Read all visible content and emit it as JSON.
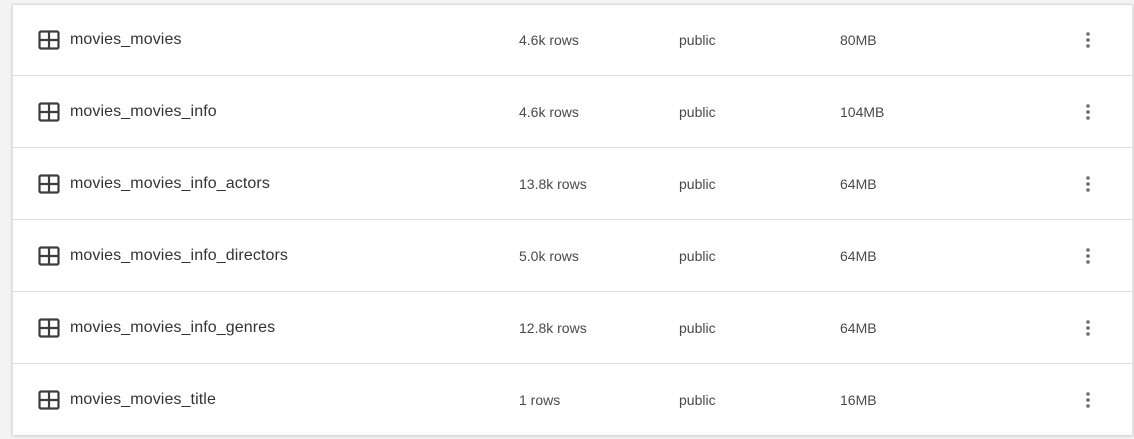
{
  "tables": [
    {
      "name": "movies_movies",
      "rows": "4.6k rows",
      "schema": "public",
      "size": "80MB",
      "icon": "table-icon",
      "menu_icon": "more-vert-icon"
    },
    {
      "name": "movies_movies_info",
      "rows": "4.6k rows",
      "schema": "public",
      "size": "104MB",
      "icon": "table-icon",
      "menu_icon": "more-vert-icon"
    },
    {
      "name": "movies_movies_info_actors",
      "rows": "13.8k rows",
      "schema": "public",
      "size": "64MB",
      "icon": "table-icon",
      "menu_icon": "more-vert-icon"
    },
    {
      "name": "movies_movies_info_directors",
      "rows": "5.0k rows",
      "schema": "public",
      "size": "64MB",
      "icon": "table-icon",
      "menu_icon": "more-vert-icon"
    },
    {
      "name": "movies_movies_info_genres",
      "rows": "12.8k rows",
      "schema": "public",
      "size": "64MB",
      "icon": "table-icon",
      "menu_icon": "more-vert-icon"
    },
    {
      "name": "movies_movies_title",
      "rows": "1 rows",
      "schema": "public",
      "size": "16MB",
      "icon": "table-icon",
      "menu_icon": "more-vert-icon"
    }
  ],
  "colors": {
    "icon": "#3c3c3c",
    "text": "#333333",
    "muted_text": "#4a4a4a",
    "divider": "#e0e0e0",
    "menu_dots": "#6b6b6b"
  }
}
